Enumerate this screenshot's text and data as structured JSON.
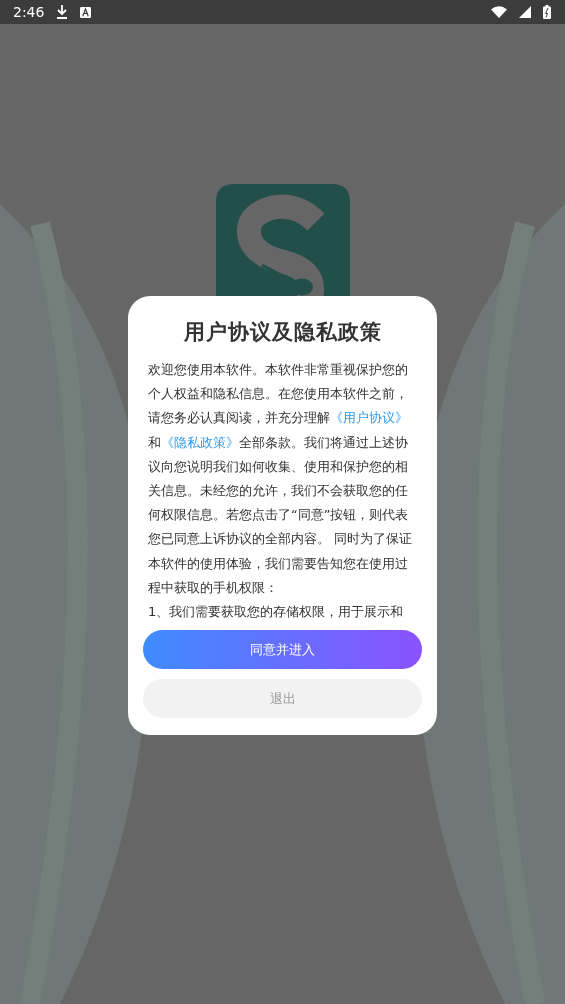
{
  "status_bar": {
    "time": "2:46"
  },
  "dialog": {
    "title": "用户协议及隐私政策",
    "body": [
      {
        "kind": "text",
        "text": "欢迎您使用本软件。本软件非常重视保护您的个人权益和隐私信息。在您使用本软件之前，请您务必认真阅读，并充分理解"
      },
      {
        "kind": "link",
        "text": "《用户协议》"
      },
      {
        "kind": "text",
        "text": "和"
      },
      {
        "kind": "link",
        "text": "《隐私政策》"
      },
      {
        "kind": "text",
        "text": "全部条款。我们将通过上述协议向您说明我们如何收集、使用和保护您的相关信息。未经您的允许，我们不会获取您的任何权限信息。若您点击了“同意”按钮，则代表您已同意上诉协议的全部内容。 同时为了保证本软件的使用体验，我们需要告知您在使用过程中获取的手机权限："
      }
    ],
    "list_item": "1、我们需要获取您的存储权限，用于展示和",
    "buttons": [
      {
        "kind": "primary",
        "label": "同意并进入"
      },
      {
        "kind": "secondary",
        "label": "退出"
      }
    ]
  }
}
